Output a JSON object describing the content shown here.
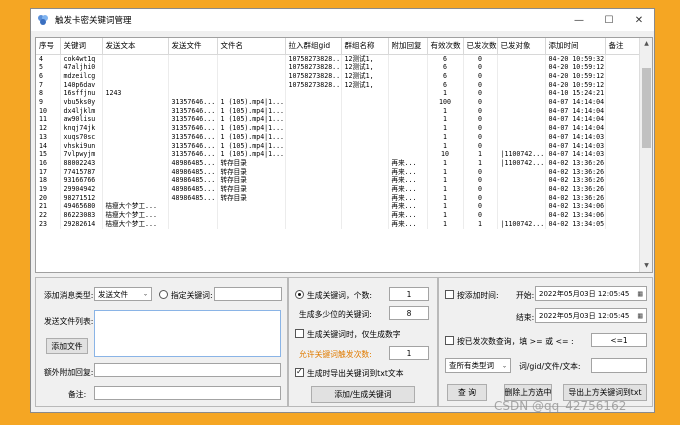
{
  "window": {
    "title": "触发卡密关键词管理",
    "controls": [
      "—",
      "☐",
      "✕"
    ]
  },
  "grid": {
    "columns": [
      "序号",
      "关键词",
      "发送文本",
      "发送文件",
      "文件名",
      "拉入群组gid",
      "群组名称",
      "附加回复",
      "有效次数",
      "已发次数",
      "已发对象",
      "添加时间",
      "备注"
    ],
    "rows": [
      [
        "4",
        "cok4wt1q",
        "",
        "",
        "",
        "10758273828...",
        "12测试1,",
        "",
        "6",
        "0",
        "",
        "04-20 10:59:32",
        ""
      ],
      [
        "5",
        "47aljhi0",
        "",
        "",
        "",
        "10758273828...",
        "12测试1,",
        "",
        "6",
        "0",
        "",
        "04-20 10:59:12",
        ""
      ],
      [
        "6",
        "mdzeilcg",
        "",
        "",
        "",
        "10758273828...",
        "12测试1,",
        "",
        "6",
        "0",
        "",
        "04-20 10:59:12",
        ""
      ],
      [
        "7",
        "140p6dav",
        "",
        "",
        "",
        "10758273828...",
        "12测试1,",
        "",
        "6",
        "0",
        "",
        "04-20 10:59:12",
        ""
      ],
      [
        "8",
        "16sffjnu",
        "1243",
        "",
        "",
        "",
        "",
        "",
        "1",
        "0",
        "",
        "04-10 15:24:21",
        ""
      ],
      [
        "9",
        "vbu5ks0y",
        "",
        "31357646...",
        "1 (105).mp4|1...",
        "",
        "",
        "",
        "100",
        "0",
        "",
        "04-07 14:14:04",
        ""
      ],
      [
        "10",
        "dx4ljklm",
        "",
        "31357646...",
        "1 (105).mp4|1...",
        "",
        "",
        "",
        "1",
        "0",
        "",
        "04-07 14:14:04",
        ""
      ],
      [
        "11",
        "aw90lisu",
        "",
        "31357646...",
        "1 (105).mp4|1...",
        "",
        "",
        "",
        "1",
        "0",
        "",
        "04-07 14:14:04",
        ""
      ],
      [
        "12",
        "knqj74jk",
        "",
        "31357646...",
        "1 (105).mp4|1...",
        "",
        "",
        "",
        "1",
        "0",
        "",
        "04-07 14:14:04",
        ""
      ],
      [
        "13",
        "xuqs70sc",
        "",
        "31357646...",
        "1 (105).mp4|1...",
        "",
        "",
        "",
        "1",
        "0",
        "",
        "04-07 14:14:03",
        ""
      ],
      [
        "14",
        "vhski9un",
        "",
        "31357646...",
        "1 (105).mp4|1...",
        "",
        "",
        "",
        "1",
        "0",
        "",
        "04-07 14:14:03",
        ""
      ],
      [
        "15",
        "7vlpwyjm",
        "",
        "31357646...",
        "1 (105).mp4|1...",
        "",
        "",
        "",
        "10",
        "1",
        "|1100742...",
        "04-07 14:14:03",
        ""
      ],
      [
        "16",
        "88002243",
        "",
        "48986485...",
        "转存目录",
        "",
        "",
        "再来...",
        "1",
        "1",
        "|1100742...",
        "04-02 13:36:26",
        ""
      ],
      [
        "17",
        "77415787",
        "",
        "48986485...",
        "转存目录",
        "",
        "",
        "再来...",
        "1",
        "0",
        "",
        "04-02 13:36:26",
        ""
      ],
      [
        "18",
        "93166766",
        "",
        "48986485...",
        "转存目录",
        "",
        "",
        "再来...",
        "1",
        "0",
        "",
        "04-02 13:36:26",
        ""
      ],
      [
        "19",
        "29904942",
        "",
        "48986485...",
        "转存目录",
        "",
        "",
        "再来...",
        "1",
        "0",
        "",
        "04-02 13:36:26",
        ""
      ],
      [
        "20",
        "98271512",
        "",
        "48986485...",
        "转存目录",
        "",
        "",
        "再来...",
        "1",
        "0",
        "",
        "04-02 13:36:26",
        ""
      ],
      [
        "21",
        "49465680",
        "桔瘦大个梦工...",
        "",
        "",
        "",
        "",
        "再来...",
        "1",
        "0",
        "",
        "04-02 13:34:06",
        ""
      ],
      [
        "22",
        "86223083",
        "桔瘦大个梦工...",
        "",
        "",
        "",
        "",
        "再来...",
        "1",
        "0",
        "",
        "04-02 13:34:06",
        ""
      ],
      [
        "23",
        "29282614",
        "桔瘦大个梦工...",
        "",
        "",
        "",
        "",
        "再来...",
        "1",
        "1",
        "|1100742...",
        "04-02 13:34:05",
        ""
      ]
    ]
  },
  "left_panel": {
    "msg_type_label": "添加消息类型:",
    "msg_type_value": "发送文件",
    "specify_keyword_label": "指定关键词:",
    "specify_keyword_value": "",
    "file_list_label": "发送文件列表:",
    "add_file_button": "添加文件",
    "extra_reply_label": "额外附加回复:",
    "extra_reply_value": "",
    "remark_label": "备注:",
    "remark_value": ""
  },
  "middle_panel": {
    "gen_keywords_label": "生成关键词，个数:",
    "gen_keywords_count": "1",
    "gen_length_label": "生成多少位的关键词:",
    "gen_length_value": "8",
    "digits_only_label": "生成关键词时，仅生成数字",
    "allow_count_label": "允许关键词触发次数:",
    "allow_count_value": "1",
    "export_txt_label": "生成时导出关键词到txt文本",
    "add_gen_button": "添加/生成关键词"
  },
  "right_panel": {
    "by_time_label": "按添加时间:",
    "start_label": "开始:",
    "start_value": "2022年05月03日  12:05:45",
    "end_label": "结束:",
    "end_value": "2022年05月03日  12:05:45",
    "by_sent_label": "按已发次数查询，填 >= 或 <= :",
    "sent_value": "<=1",
    "query_type_value": "查所有类型词",
    "query_field_label": "词/gid/文件/文本:",
    "query_field_value": "",
    "query_button": "查 询",
    "delete_button": "删除上方选中",
    "export_button": "导出上方关键词到txt"
  },
  "watermark": "CSDN @qq_42756162",
  "colors": {
    "frame": "#f5a623",
    "accent_text": "#e07b00"
  }
}
